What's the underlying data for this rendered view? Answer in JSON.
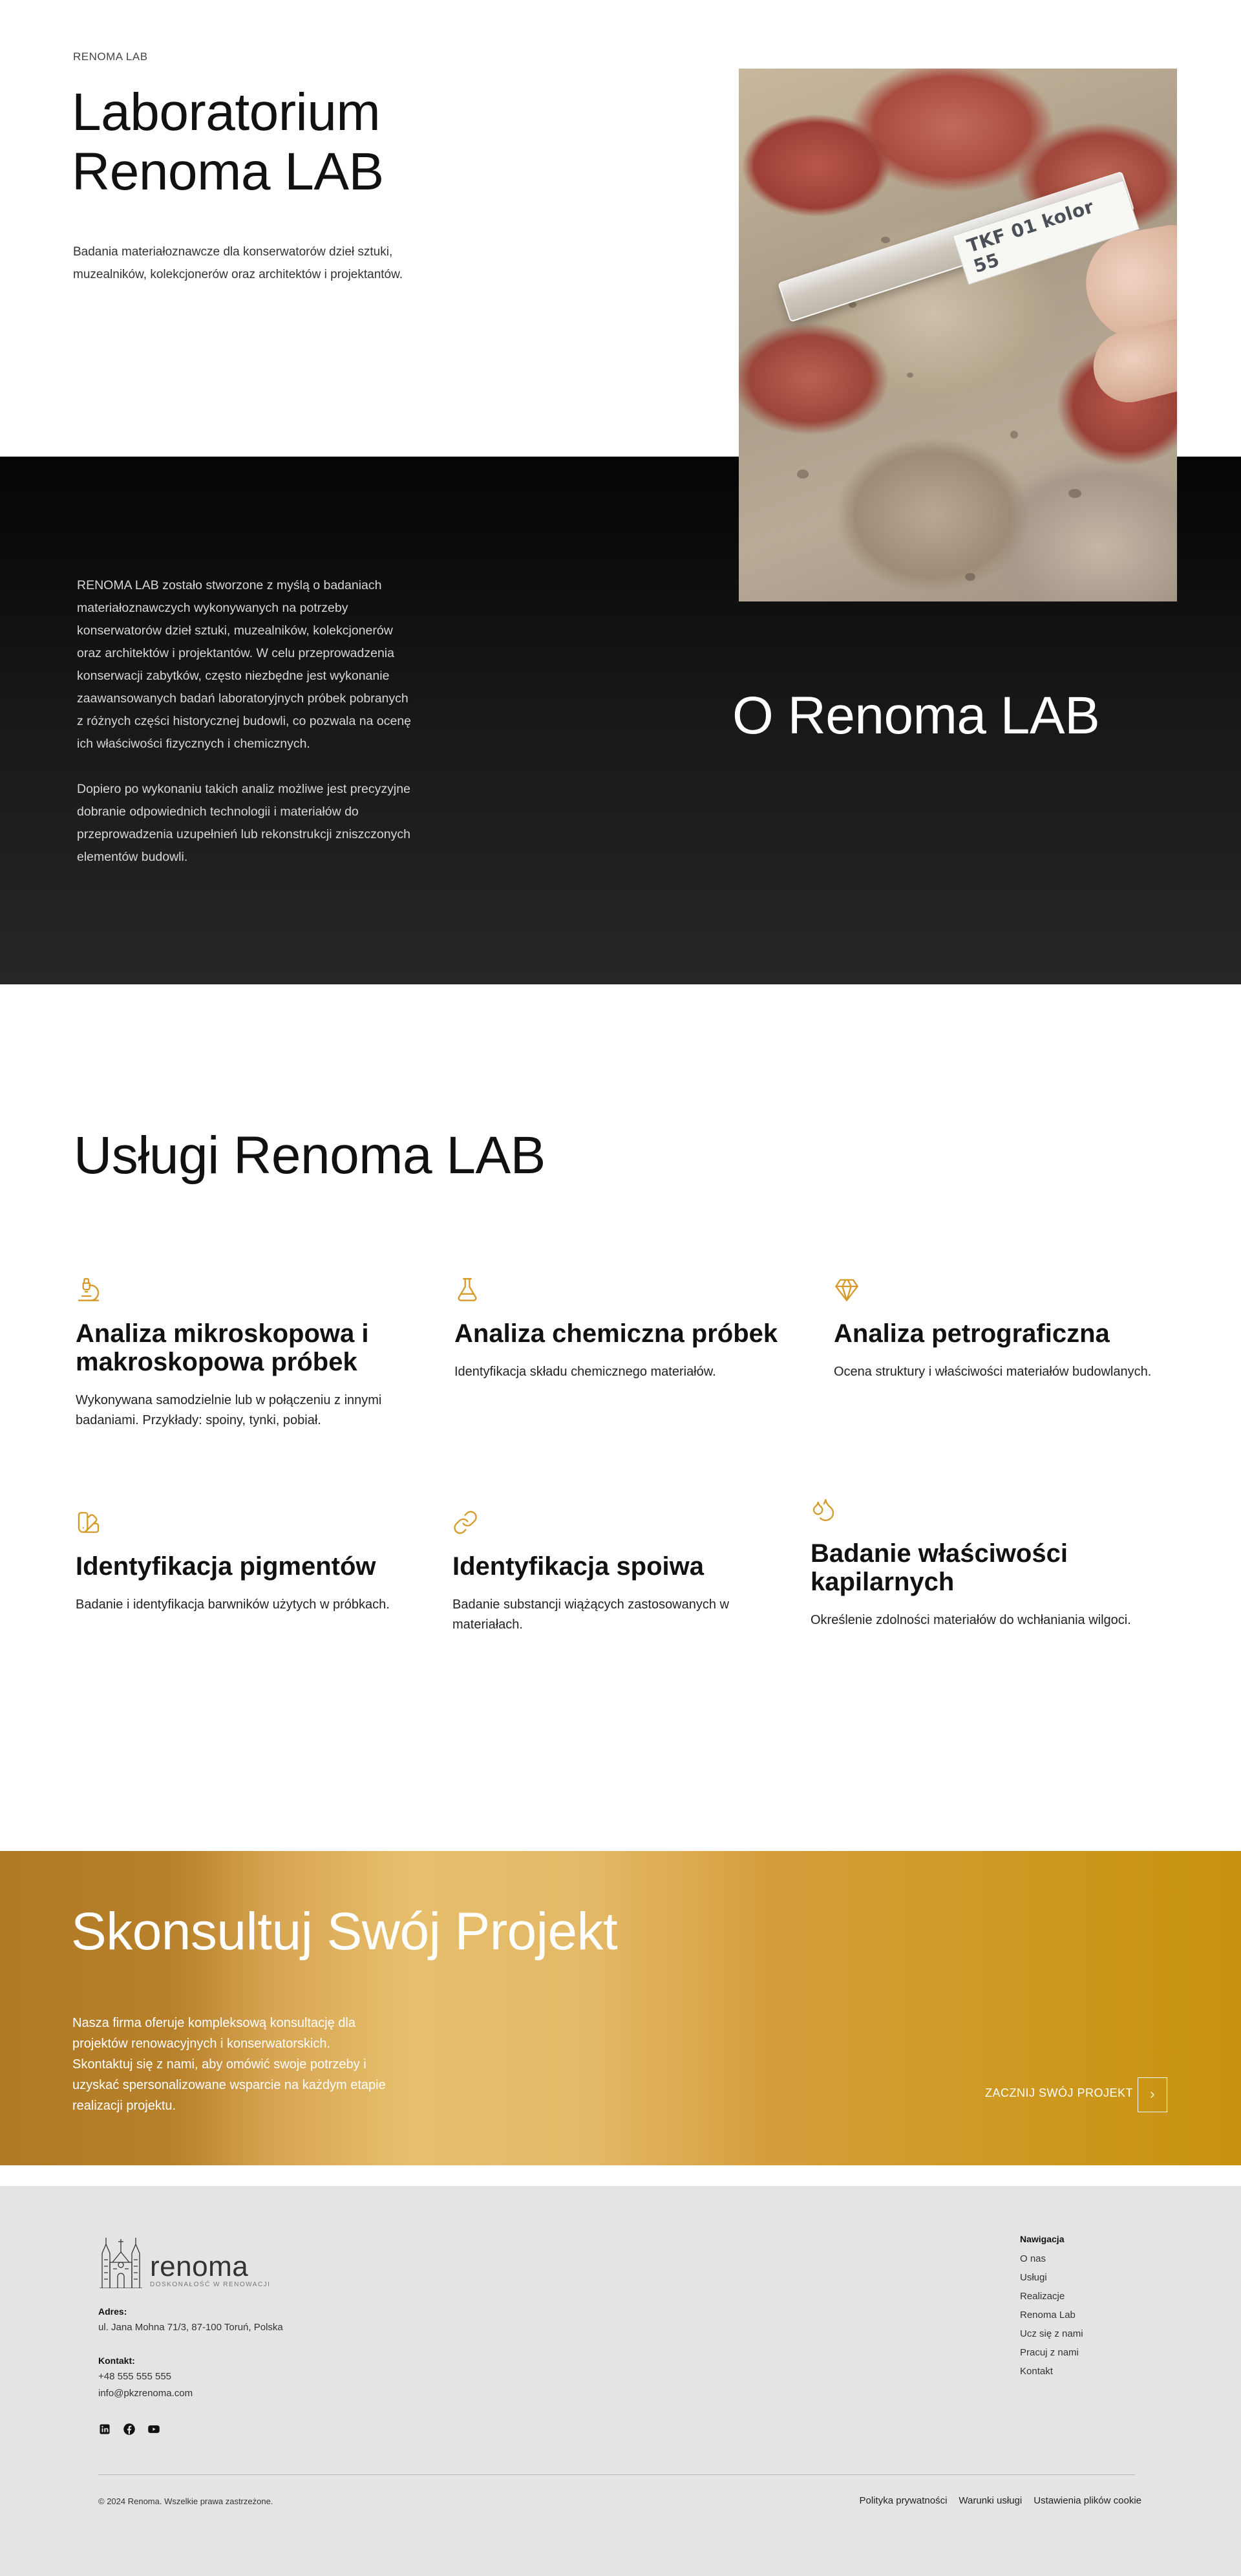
{
  "hero": {
    "eyebrow": "RENOMA LAB",
    "title_line1": "Laboratorium",
    "title_line2": "Renoma LAB",
    "lead": "Badania materiałoznawcze dla konserwatorów dzieł sztuki, muzealników, kolekcjonerów oraz architektów i projektantów.",
    "photo_label": "TKF 01 kolor 55"
  },
  "about": {
    "paragraph1": "RENOMA LAB zostało stworzone z myślą o badaniach materiałoznawczych wykonywanych na potrzeby konserwatorów dzieł sztuki, muzealników, kolekcjonerów oraz architektów i projektantów. W celu przeprowadzenia konserwacji zabytków, często niezbędne jest wykonanie zaawansowanych badań laboratoryjnych próbek pobranych z różnych części historycznej budowli, co pozwala na ocenę ich właściwości fizycznych i chemicznych.",
    "paragraph2": "Dopiero po wykonaniu takich analiz możliwe jest precyzyjne dobranie odpowiednich technologii i materiałów do przeprowadzenia uzupełnień lub rekonstrukcji zniszczonych elementów budowli.",
    "heading": "O Renoma LAB"
  },
  "services": {
    "heading": "Usługi Renoma LAB",
    "accent_color": "#d49a2a",
    "items": [
      {
        "icon": "microscope-icon",
        "title": "Analiza mikroskopowa i makroskopowa próbek",
        "text": "Wykonywana samodzielnie lub w połączeniu z innymi badaniami. Przykłady: spoiny, tynki, pobiał."
      },
      {
        "icon": "flask-icon",
        "title": "Analiza chemiczna próbek",
        "text": "Identyfikacja składu chemicznego materiałów."
      },
      {
        "icon": "gem-icon",
        "title": "Analiza petrograficzna",
        "text": "Ocena struktury i właściwości materiałów budowlanych."
      },
      {
        "icon": "swatch-icon",
        "title": "Identyfikacja pigmentów",
        "text": "Badanie i identyfikacja barwników użytych w próbkach."
      },
      {
        "icon": "link-icon",
        "title": "Identyfikacja spoiwa",
        "text": "Badanie substancji wiążących zastosowanych w materiałach."
      },
      {
        "icon": "droplets-icon",
        "title": "Badanie właściwości kapilarnych",
        "text": "Określenie zdolności materiałów do wchłaniania wilgoci."
      }
    ]
  },
  "consult": {
    "heading": "Skonsultuj Swój Projekt",
    "text": "Nasza firma oferuje kompleksową konsultację dla projektów renowacyjnych i konserwatorskich. Skontaktuj się z nami, aby omówić swoje potrzeby i uzyskać spersonalizowane wsparcie na każdym etapie realizacji projektu.",
    "cta_label": "ZACZNIJ SWÓJ PROJEKT"
  },
  "footer": {
    "logo_word": "renoma",
    "logo_tag": "DOSKONAŁOŚĆ W RENOWACJI",
    "address_label": "Adres:",
    "address": "ul. Jana Mohna 71/3, 87-100 Toruń, Polska",
    "contact_label": "Kontakt:",
    "phone": "+48 555 555 555",
    "email": "info@pkzrenoma.com",
    "social": [
      "linkedin-icon",
      "facebook-icon",
      "youtube-icon"
    ],
    "nav_title": "Nawigacja",
    "nav": [
      "O nas",
      "Usługi",
      "Realizacje",
      "Renoma Lab",
      "Ucz się z nami",
      "Pracuj z nami",
      "Kontakt"
    ],
    "copyright": "© 2024 Renoma. Wszelkie prawa zastrzeżone.",
    "legal": [
      "Polityka prywatności",
      "Warunki usługi",
      "Ustawienia plików cookie"
    ]
  }
}
